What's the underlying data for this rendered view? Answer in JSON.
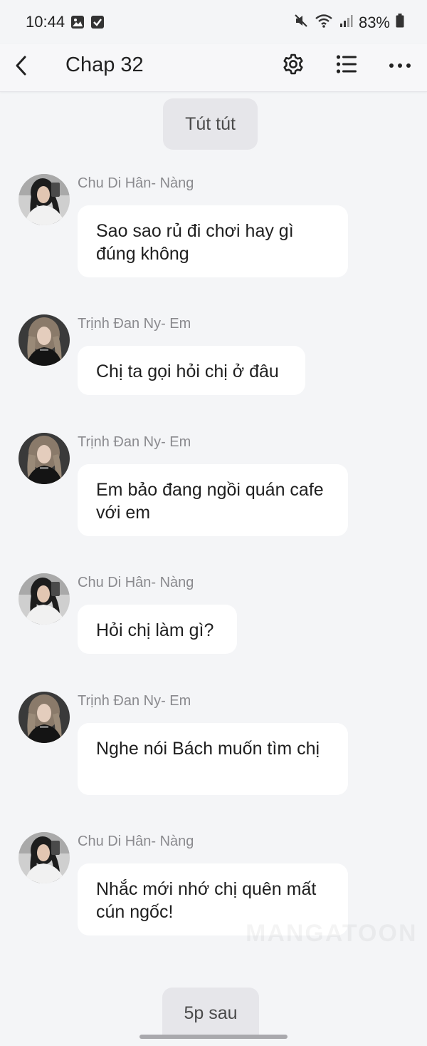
{
  "status_bar": {
    "time": "10:44",
    "battery": "83%"
  },
  "header": {
    "title": "Chap 32"
  },
  "system_messages": {
    "top": "Tút tút",
    "bottom": "5p sau"
  },
  "messages": [
    {
      "sender": "Chu Di Hân- Nàng",
      "text": "Sao sao rủ đi chơi hay gì đúng không"
    },
    {
      "sender": "Trịnh Đan Ny- Em",
      "text": "Chị ta gọi hỏi chị ở đâu"
    },
    {
      "sender": "Trịnh Đan Ny- Em",
      "text": "Em bảo đang ngồi quán cafe với em"
    },
    {
      "sender": "Chu Di Hân- Nàng",
      "text": "Hỏi chị làm gì?"
    },
    {
      "sender": "Trịnh Đan Ny- Em",
      "text": "Nghe nói Bách muốn tìm chị"
    },
    {
      "sender": "Chu Di Hân- Nàng",
      "text": "Nhắc mới nhớ chị quên mất cún ngốc!"
    }
  ],
  "watermark": "MANGATOON",
  "icons": {
    "back": "back-arrow-icon",
    "settings": "gear-icon",
    "list": "list-icon",
    "more": "more-icon"
  }
}
